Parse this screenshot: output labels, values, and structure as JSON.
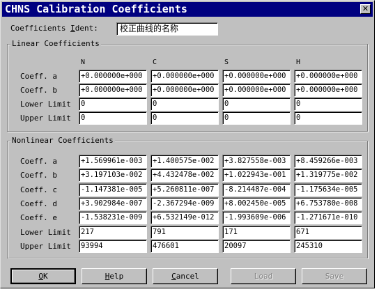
{
  "window": {
    "title": "CHNS Calibration Coefficients",
    "close_glyph": "✕"
  },
  "ident": {
    "label_prefix": "Coefficients ",
    "label_mnemonic": "I",
    "label_suffix": "dent:",
    "value": "校正曲线的名称"
  },
  "linear": {
    "title": "Linear Coefficients",
    "columns": [
      "N",
      "C",
      "S",
      "H"
    ],
    "rows": [
      {
        "label": "Coeff. a",
        "values": [
          "+0.000000e+000",
          "+0.000000e+000",
          "+0.000000e+000",
          "+0.000000e+000"
        ]
      },
      {
        "label": "Coeff. b",
        "values": [
          "+0.000000e+000",
          "+0.000000e+000",
          "+0.000000e+000",
          "+0.000000e+000"
        ]
      },
      {
        "label": "Lower Limit",
        "values": [
          "0",
          "0",
          "0",
          "0"
        ]
      },
      {
        "label": "Upper Limit",
        "values": [
          "0",
          "0",
          "0",
          "0"
        ]
      }
    ]
  },
  "nonlinear": {
    "title": "Nonlinear Coefficients",
    "rows": [
      {
        "label": "Coeff. a",
        "values": [
          "+1.569961e-003",
          "+1.400575e-002",
          "+3.827558e-003",
          "+8.459266e-003"
        ]
      },
      {
        "label": "Coeff. b",
        "values": [
          "+3.197103e-002",
          "+4.432478e-002",
          "+1.022943e-001",
          "+1.319775e-002"
        ]
      },
      {
        "label": "Coeff. c",
        "values": [
          "-1.147381e-005",
          "+5.260811e-007",
          "-8.214487e-004",
          "-1.175634e-005"
        ]
      },
      {
        "label": "Coeff. d",
        "values": [
          "+3.902984e-007",
          "-2.367294e-009",
          "+8.002450e-005",
          "+6.753780e-008"
        ]
      },
      {
        "label": "Coeff. e",
        "values": [
          "-1.538231e-009",
          "+6.532149e-012",
          "-1.993609e-006",
          "-1.271671e-010"
        ]
      },
      {
        "label": "Lower Limit",
        "values": [
          "217",
          "791",
          "171",
          "671"
        ]
      },
      {
        "label": "Upper Limit",
        "values": [
          "93994",
          "476601",
          "20097",
          "245310"
        ]
      }
    ]
  },
  "buttons": {
    "ok": {
      "mnemonic": "O",
      "rest": "K"
    },
    "help": {
      "mnemonic": "H",
      "rest": "elp"
    },
    "cancel": {
      "mnemonic": "C",
      "rest": "ancel"
    },
    "load": {
      "label": "Load"
    },
    "save": {
      "label": "Save"
    }
  }
}
